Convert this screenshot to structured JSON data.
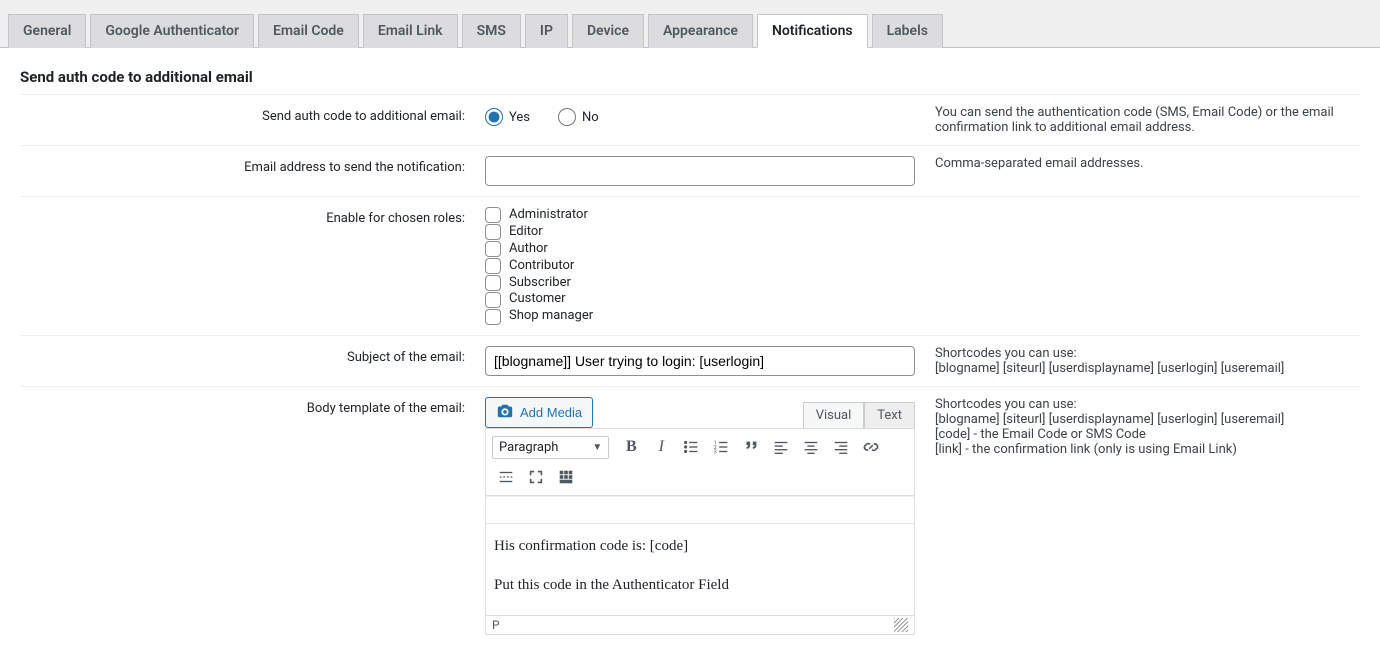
{
  "tabs": [
    {
      "label": "General"
    },
    {
      "label": "Google Authenticator"
    },
    {
      "label": "Email Code"
    },
    {
      "label": "Email Link"
    },
    {
      "label": "SMS"
    },
    {
      "label": "IP"
    },
    {
      "label": "Device"
    },
    {
      "label": "Appearance"
    },
    {
      "label": "Notifications",
      "active": true
    },
    {
      "label": "Labels"
    }
  ],
  "section_heading": "Send auth code to additional email",
  "rows": {
    "send_code": {
      "label": "Send auth code to additional email:",
      "yes": "Yes",
      "no": "No",
      "value": "Yes",
      "help": "You can send the authentication code (SMS, Email Code) or the email confirmation link to additional email address."
    },
    "email_addr": {
      "label": "Email address to send the notification:",
      "value": "",
      "help": "Comma-separated email addresses."
    },
    "roles": {
      "label": "Enable for chosen roles:",
      "items": [
        "Administrator",
        "Editor",
        "Author",
        "Contributor",
        "Subscriber",
        "Customer",
        "Shop manager"
      ]
    },
    "subject": {
      "label": "Subject of the email:",
      "value": "[[blogname]] User trying to login: [userlogin]",
      "help": "Shortcodes you can use:\n[blogname] [siteurl] [userdisplayname] [userlogin] [useremail]"
    },
    "body": {
      "label": "Body template of the email:",
      "add_media": "Add Media",
      "tabs": {
        "visual": "Visual",
        "text": "Text"
      },
      "format": "Paragraph",
      "content_line1": "His confirmation code is: [code]",
      "content_line2": "Put this code in the Authenticator Field",
      "status_path": "P",
      "help": "Shortcodes you can use:\n[blogname] [siteurl] [userdisplayname] [userlogin] [useremail]\n[code] - the Email Code or SMS Code\n[link] - the confirmation link (only is using Email Link)"
    }
  }
}
